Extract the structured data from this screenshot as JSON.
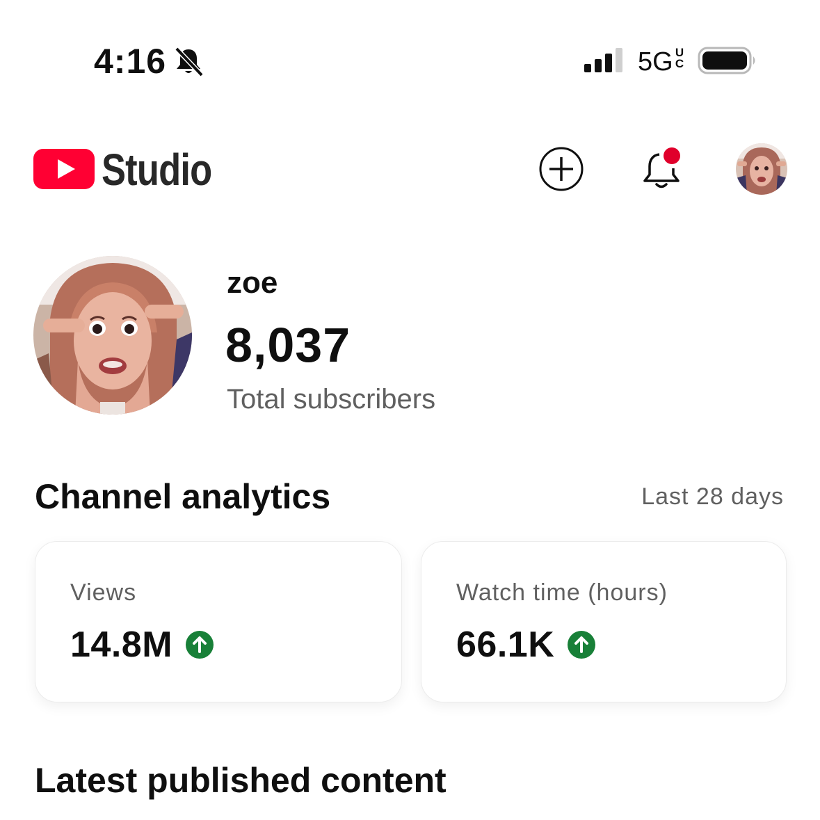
{
  "status_bar": {
    "time": "4:16",
    "network": "5G",
    "network_sub": "UC"
  },
  "header": {
    "app_name": "Studio",
    "brand_color": "#ff0033"
  },
  "channel": {
    "name": "zoe",
    "subscriber_count": "8,037",
    "subscriber_caption": "Total subscribers"
  },
  "analytics": {
    "title": "Channel analytics",
    "range": "Last 28 days",
    "metrics": [
      {
        "label": "Views",
        "value": "14.8M",
        "trend": "up"
      },
      {
        "label": "Watch time (hours)",
        "value": "66.1K",
        "trend": "up"
      }
    ],
    "trend_up_color": "#188038"
  },
  "latest": {
    "title": "Latest published content"
  }
}
